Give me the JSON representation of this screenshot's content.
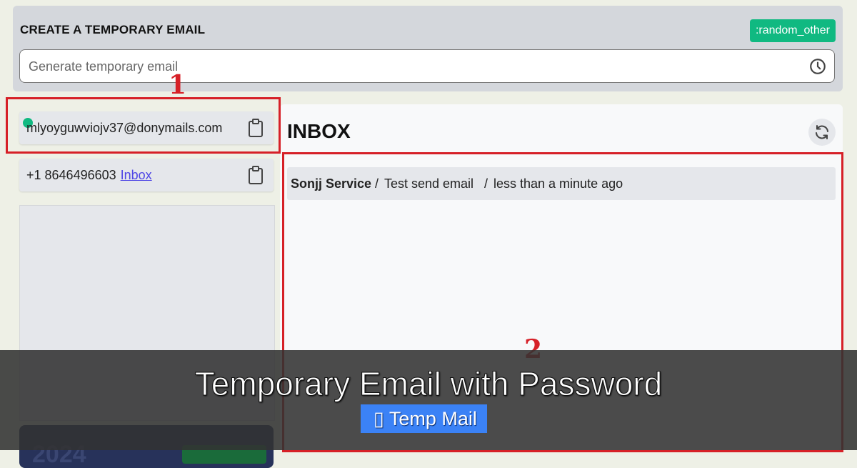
{
  "header": {
    "title": "CREATE A TEMPORARY EMAIL",
    "random_button": ":random_other",
    "input_placeholder": "Generate temporary email"
  },
  "sidebar": {
    "email_address": "mlyoyguwviojv37@donymails.com",
    "phone_number": "+1 8646496603",
    "phone_inbox_link": "Inbox",
    "promo_year": "2024"
  },
  "inbox": {
    "title": "INBOX",
    "messages": [
      {
        "sender": "Sonjj Service",
        "subject": "Test send email",
        "time": "less than a minute ago"
      }
    ]
  },
  "callouts": [
    "1",
    "2"
  ],
  "overlay": {
    "title": "Temporary Email with Password",
    "tag": "Temp Mail"
  },
  "colors": {
    "accent_green": "#10b981",
    "callout_red": "#d62027",
    "tag_blue": "#3b82f6"
  },
  "icons": [
    "history-icon",
    "clipboard-icon",
    "refresh-icon",
    "status-dot"
  ]
}
